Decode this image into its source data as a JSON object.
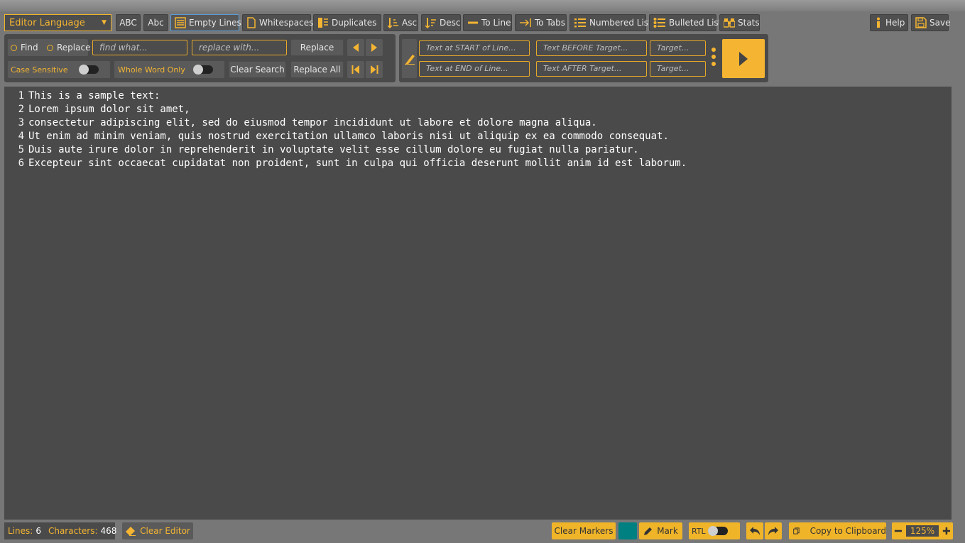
{
  "language_select": {
    "value": "Editor Language"
  },
  "toolbar": {
    "uppercase": "ABC",
    "titlecase": "Abc",
    "empty_lines": "Empty Lines",
    "whitespaces": "Whitespaces",
    "duplicates": "Duplicates",
    "asc": "Asc",
    "desc": "Desc",
    "to_line": "To Line",
    "to_tabs": "To Tabs",
    "numbered_list": "Numbered List",
    "bulleted_list": "Bulleted List",
    "stats": "Stats",
    "help": "Help",
    "save": "Save"
  },
  "find_replace": {
    "find_label": "Find",
    "replace_label": "Replace",
    "find_placeholder": "find what...",
    "replace_placeholder": "replace with...",
    "replace_button": "Replace",
    "case_sensitive": "Case Sensitive",
    "whole_word": "Whole Word Only",
    "clear_search": "Clear Search",
    "replace_all": "Replace All"
  },
  "line_tools": {
    "start_placeholder": "Text at START of Line...",
    "end_placeholder": "Text at END of Line...",
    "before_placeholder": "Text BEFORE Target...",
    "after_placeholder": "Text AFTER Target...",
    "target1_placeholder": "Target...",
    "target2_placeholder": "Target..."
  },
  "editor": {
    "lines": [
      {
        "no": "1",
        "text": "This is a sample text:"
      },
      {
        "no": "2",
        "text": "Lorem ipsum dolor sit amet,"
      },
      {
        "no": "3",
        "text": "consectetur adipiscing elit, sed do eiusmod tempor incididunt ut labore et dolore magna aliqua."
      },
      {
        "no": "4",
        "text": "Ut enim ad minim veniam, quis nostrud exercitation ullamco laboris nisi ut aliquip ex ea commodo consequat."
      },
      {
        "no": "5",
        "text": "Duis aute irure dolor in reprehenderit in voluptate velit esse cillum dolore eu fugiat nulla pariatur."
      },
      {
        "no": "6",
        "text": "Excepteur sint occaecat cupidatat non proident, sunt in culpa qui officia deserunt mollit anim id est laborum."
      }
    ]
  },
  "status": {
    "lines_label": "Lines:",
    "lines_value": "6",
    "chars_label": "Characters:",
    "chars_value": "468",
    "clear_editor": "Clear Editor",
    "clear_markers": "Clear Markers",
    "mark": "Mark",
    "rtl": "RTL",
    "copy": "Copy to Clipboard",
    "zoom": "125%"
  },
  "colors": {
    "accent": "#f5b532",
    "marker": "#008080",
    "panel": "#4a4a4a",
    "background": "#777777"
  }
}
